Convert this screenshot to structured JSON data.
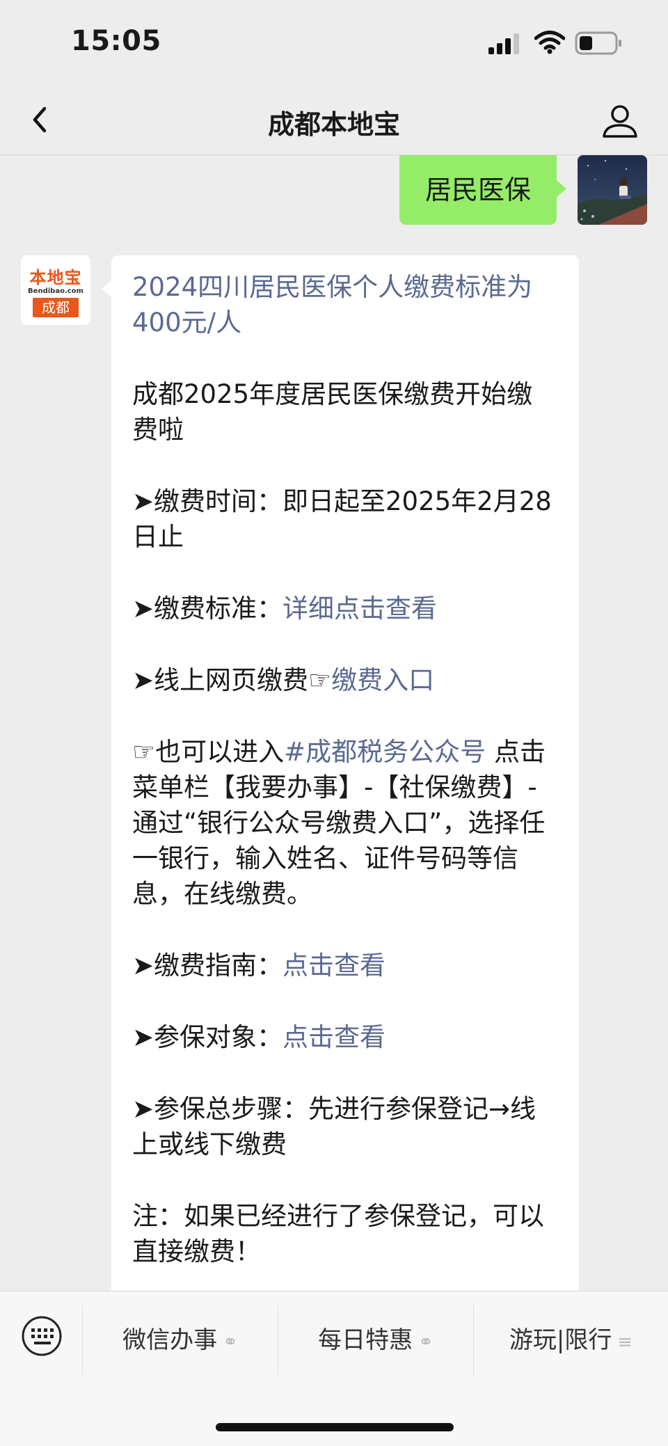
{
  "status_bar": {
    "time": "15:05",
    "icons": [
      "cellular-signal-icon",
      "wifi-icon",
      "battery-icon"
    ]
  },
  "nav": {
    "title": "成都本地宝",
    "left_icon": "back-chevron-icon",
    "right_icon": "profile-icon"
  },
  "outgoing_message": {
    "text": "居民医保",
    "bubble_color": "#95ec69"
  },
  "sender": {
    "logo_name": "本地宝",
    "logo_url": "Bendibao.com",
    "logo_city": "成都",
    "brand_color": "#e8571b"
  },
  "message": {
    "headline": "2024四川居民医保个人缴费标准为400元/人",
    "intro": "成都2025年度居民医保缴费开始缴费啦",
    "time_line": "➤缴费时间：即日起至2025年2月28日止",
    "standard_label": "➤缴费标准：",
    "standard_link": "详细点击查看",
    "online_label": "➤线上网页缴费☞",
    "online_link": "缴费入口",
    "tax_prefix": "☞也可以进入",
    "tax_link": "#成都税务公众号",
    "tax_rest": " 点击菜单栏【我要办事】-【社保缴费】-通过“银行公众号缴费入口”，选择任一银行，输入姓名、证件号码等信息，在线缴费。",
    "guide_label": "➤缴费指南：",
    "guide_link": "点击查看",
    "target_label": "➤参保对象：",
    "target_link": "点击查看",
    "steps_line": "➤参保总步骤：先进行参保登记→线上或线下缴费",
    "note_line": "注：如果已经进行了参保登记，可以直接缴费！",
    "link_color": "#5b6a91"
  },
  "bottom_menu": {
    "keyboard_icon": "keyboard-icon",
    "items": [
      {
        "label": "微信办事",
        "icon": "link-icon"
      },
      {
        "label": "每日特惠",
        "icon": "link-icon"
      },
      {
        "label": "游玩|限行",
        "icon": "menu-lines-icon"
      }
    ]
  }
}
